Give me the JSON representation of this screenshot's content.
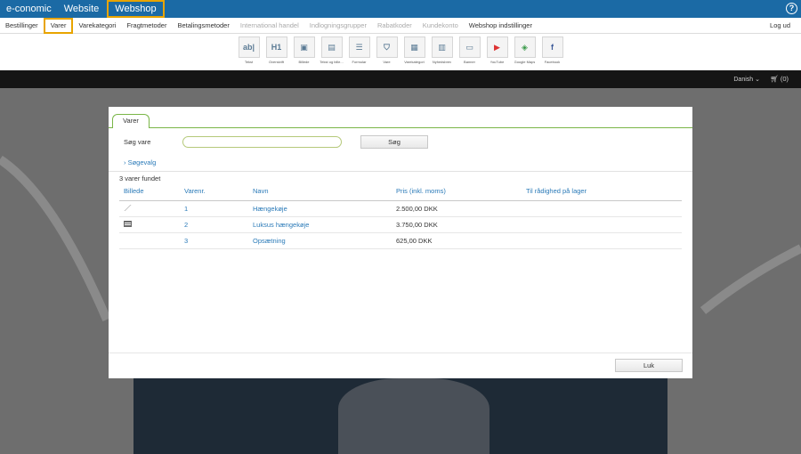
{
  "topbar": {
    "brand": "e-conomic",
    "nav": [
      {
        "label": "Website",
        "active": false
      },
      {
        "label": "Webshop",
        "active": true
      }
    ],
    "help_glyph": "?"
  },
  "subnav": {
    "items": [
      {
        "label": "Bestillinger",
        "state": "normal"
      },
      {
        "label": "Varer",
        "state": "active"
      },
      {
        "label": "Varekategori",
        "state": "normal"
      },
      {
        "label": "Fragtmetoder",
        "state": "normal"
      },
      {
        "label": "Betalingsmetoder",
        "state": "normal"
      },
      {
        "label": "International handel",
        "state": "disabled"
      },
      {
        "label": "Indlogningsgrupper",
        "state": "disabled"
      },
      {
        "label": "Rabatkoder",
        "state": "disabled"
      },
      {
        "label": "Kundekonto",
        "state": "disabled"
      },
      {
        "label": "Webshop indstillinger",
        "state": "normal"
      }
    ],
    "logout": "Log ud"
  },
  "toolbar": {
    "tools": [
      {
        "label": "Tekst",
        "glyph": "ab|",
        "icon": "text-icon"
      },
      {
        "label": "Overskrift",
        "glyph": "H1",
        "icon": "heading-icon"
      },
      {
        "label": "Billede",
        "glyph": "▣",
        "icon": "image-icon"
      },
      {
        "label": "Tekst og bille...",
        "glyph": "▤",
        "icon": "text-image-icon"
      },
      {
        "label": "Formular",
        "glyph": "☰",
        "icon": "form-icon"
      },
      {
        "label": "Vare",
        "glyph": "⛉",
        "icon": "product-icon"
      },
      {
        "label": "Varekategori",
        "glyph": "▦",
        "icon": "category-icon"
      },
      {
        "label": "Nyhedsbrev",
        "glyph": "▥",
        "icon": "newsletter-icon"
      },
      {
        "label": "Banner",
        "glyph": "▭",
        "icon": "banner-icon"
      },
      {
        "label": "YouTube",
        "glyph": "▶",
        "icon": "youtube-icon"
      },
      {
        "label": "Google Maps",
        "glyph": "◈",
        "icon": "google-maps-icon"
      },
      {
        "label": "Facebook",
        "glyph": "f",
        "icon": "facebook-icon"
      }
    ]
  },
  "storebar": {
    "language": "Danish",
    "cart": "(0)"
  },
  "modal": {
    "tab": "Varer",
    "search_label": "Søg vare",
    "search_value": "",
    "search_button": "Søg",
    "options_link": "› Søgevalg",
    "result_count": "3 varer fundet",
    "columns": {
      "image": "Billede",
      "number": "Varenr.",
      "name": "Navn",
      "price": "Pris (inkl. moms)",
      "stock": "Til rådighed på lager"
    },
    "rows": [
      {
        "number": "1",
        "name": "Hængekøje",
        "price": "2.500,00 DKK",
        "stock": ""
      },
      {
        "number": "2",
        "name": "Luksus hængekøje",
        "price": "3.750,00 DKK",
        "stock": ""
      },
      {
        "number": "3",
        "name": "Opsætning",
        "price": "625,00 DKK",
        "stock": ""
      }
    ],
    "close_button": "Luk"
  },
  "colors": {
    "topbar_bg": "#1b6aa5",
    "highlight_border": "#e8a400",
    "tab_green": "#7ab648",
    "link_blue": "#2a7ab8",
    "store_header": "#151515"
  }
}
